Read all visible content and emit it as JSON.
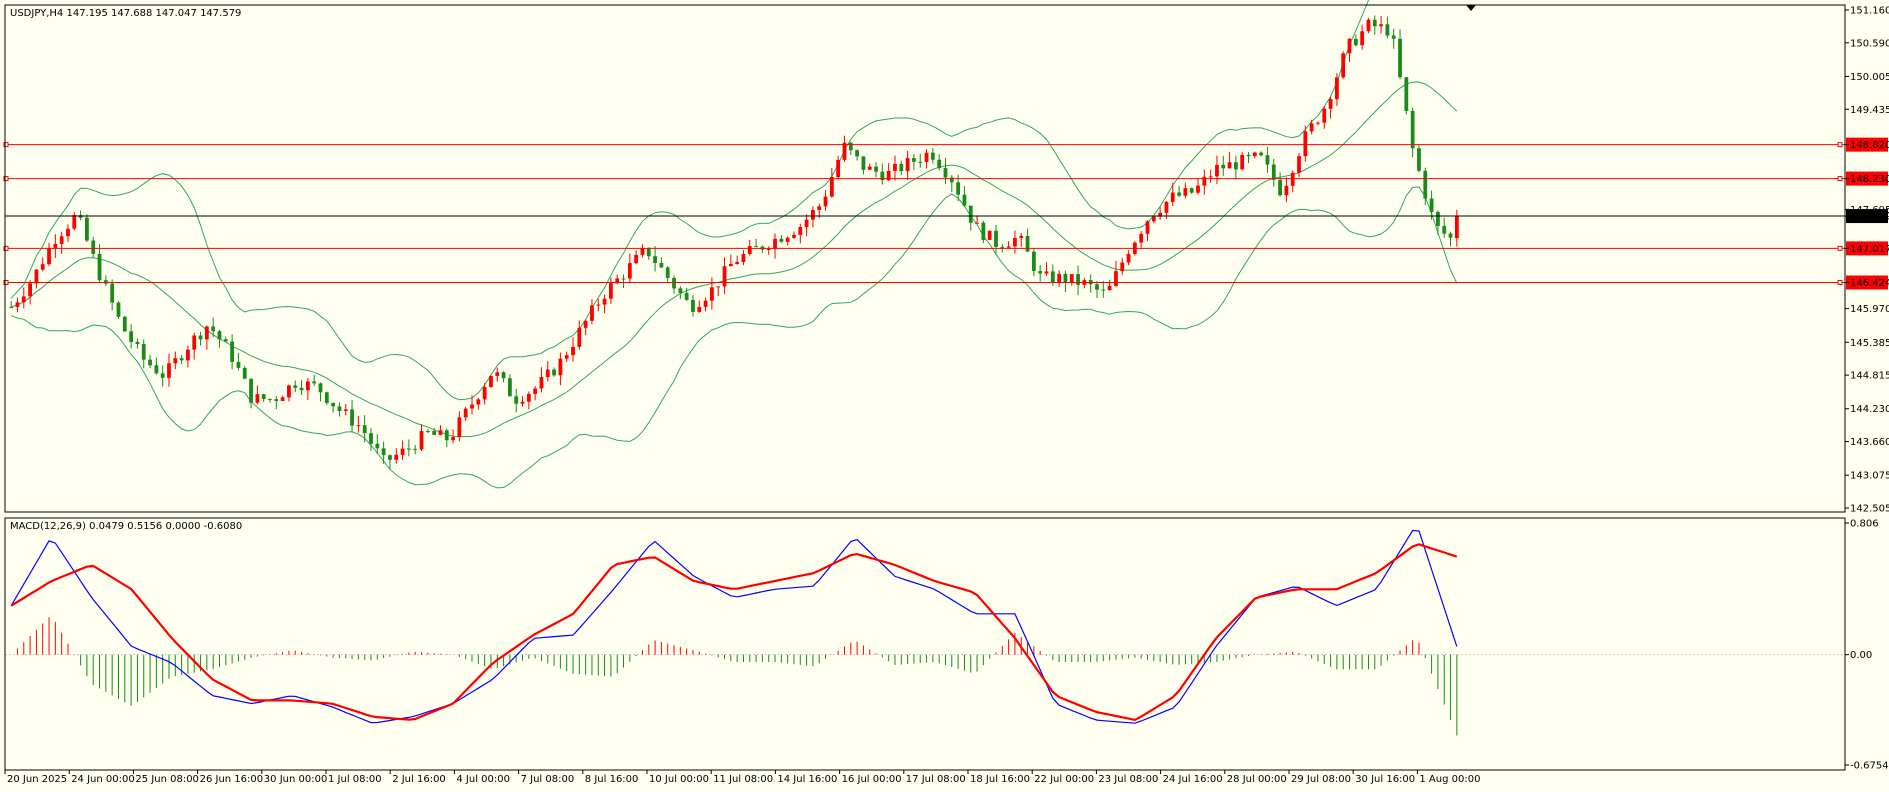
{
  "chart_data": {
    "type": "candlestick",
    "symbol_header": "USDJPY,H4  147.195 147.688 147.047 147.579",
    "ohlc_last": {
      "open": 147.195,
      "high": 147.688,
      "low": 147.047,
      "close": 147.579
    },
    "price_axis": {
      "ticks": [
        "151.160",
        "150.590",
        "150.005",
        "149.435",
        "148.820",
        "148.230",
        "147.695",
        "147.579",
        "147.017",
        "146.424",
        "145.970",
        "145.385",
        "144.815",
        "144.230",
        "143.660",
        "143.075",
        "142.505"
      ],
      "range": [
        142.505,
        151.16
      ]
    },
    "levels": [
      {
        "name": "resistance-1",
        "value": 148.82,
        "label": "148.820",
        "color": "#ff0000"
      },
      {
        "name": "resistance-2",
        "value": 148.23,
        "label": "148.230",
        "color": "#ff0000"
      },
      {
        "name": "current-price",
        "value": 147.579,
        "label": "147.579",
        "color": "#000000"
      },
      {
        "name": "support-1",
        "value": 147.017,
        "label": "147.017",
        "color": "#ff0000"
      },
      {
        "name": "support-2",
        "value": 146.424,
        "label": "146.424",
        "color": "#ff0000"
      }
    ],
    "time_axis": [
      "20 Jun 2025",
      "24 Jun 00:00",
      "25 Jun 08:00",
      "26 Jun 16:00",
      "30 Jun 00:00",
      "1 Jul 08:00",
      "2 Jul 16:00",
      "4 Jul 00:00",
      "7 Jul 08:00",
      "8 Jul 16:00",
      "10 Jul 00:00",
      "11 Jul 08:00",
      "14 Jul 16:00",
      "16 Jul 00:00",
      "17 Jul 08:00",
      "18 Jul 16:00",
      "22 Jul 00:00",
      "23 Jul 08:00",
      "24 Jul 16:00",
      "28 Jul 00:00",
      "29 Jul 08:00",
      "30 Jul 16:00",
      "1 Aug 00:00"
    ],
    "price_path_keypoints": [
      146.0,
      146.5,
      147.2,
      147.6,
      146.6,
      145.7,
      145.1,
      144.8,
      145.3,
      145.7,
      145.2,
      144.4,
      144.4,
      144.7,
      144.6,
      144.2,
      143.9,
      143.3,
      143.5,
      143.8,
      143.7,
      144.3,
      144.9,
      144.4,
      144.6,
      145.0,
      145.6,
      146.2,
      146.6,
      147.0,
      146.5,
      146.0,
      146.3,
      146.8,
      147.0,
      147.2,
      147.4,
      147.8,
      148.8,
      148.4,
      148.3,
      148.5,
      148.7,
      148.2,
      147.4,
      147.1,
      147.2,
      146.5,
      146.5,
      146.4,
      146.2,
      147.0,
      147.6,
      147.9,
      148.0,
      148.4,
      148.5,
      148.6,
      148.0,
      148.9,
      149.5,
      150.5,
      150.9,
      150.8,
      148.7,
      147.4,
      147.1
    ],
    "indicator": {
      "name": "MACD",
      "header": "MACD(12,26,9) 0.0479 0.5156 0.0000 -0.6080",
      "axis_ticks": [
        "0.806",
        "0.00",
        "-0.6754"
      ],
      "range": [
        -0.6754,
        0.806
      ],
      "macd_line_keypoints": [
        0.3,
        0.72,
        0.35,
        0.05,
        -0.05,
        -0.25,
        -0.3,
        -0.25,
        -0.32,
        -0.42,
        -0.38,
        -0.3,
        -0.15,
        0.1,
        0.12,
        0.4,
        0.7,
        0.48,
        0.35,
        0.4,
        0.42,
        0.72,
        0.48,
        0.4,
        0.25,
        0.25,
        -0.3,
        -0.4,
        -0.42,
        -0.32,
        0.05,
        0.35,
        0.42,
        0.3,
        0.4,
        0.8,
        0.05
      ],
      "signal_line_keypoints": [
        0.3,
        0.45,
        0.55,
        0.4,
        0.1,
        -0.15,
        -0.28,
        -0.28,
        -0.3,
        -0.38,
        -0.4,
        -0.3,
        -0.05,
        0.12,
        0.25,
        0.55,
        0.6,
        0.45,
        0.4,
        0.45,
        0.5,
        0.62,
        0.55,
        0.45,
        0.38,
        0.1,
        -0.25,
        -0.35,
        -0.4,
        -0.25,
        0.1,
        0.35,
        0.4,
        0.4,
        0.5,
        0.68,
        0.6
      ]
    },
    "colors": {
      "up": "#ff0000",
      "down": "#1a8a1a",
      "bollinger": "#2ea865",
      "macd": "#0000ff",
      "signal": "#ff0000",
      "level": "#ff0000",
      "price_line": "#000000"
    }
  }
}
